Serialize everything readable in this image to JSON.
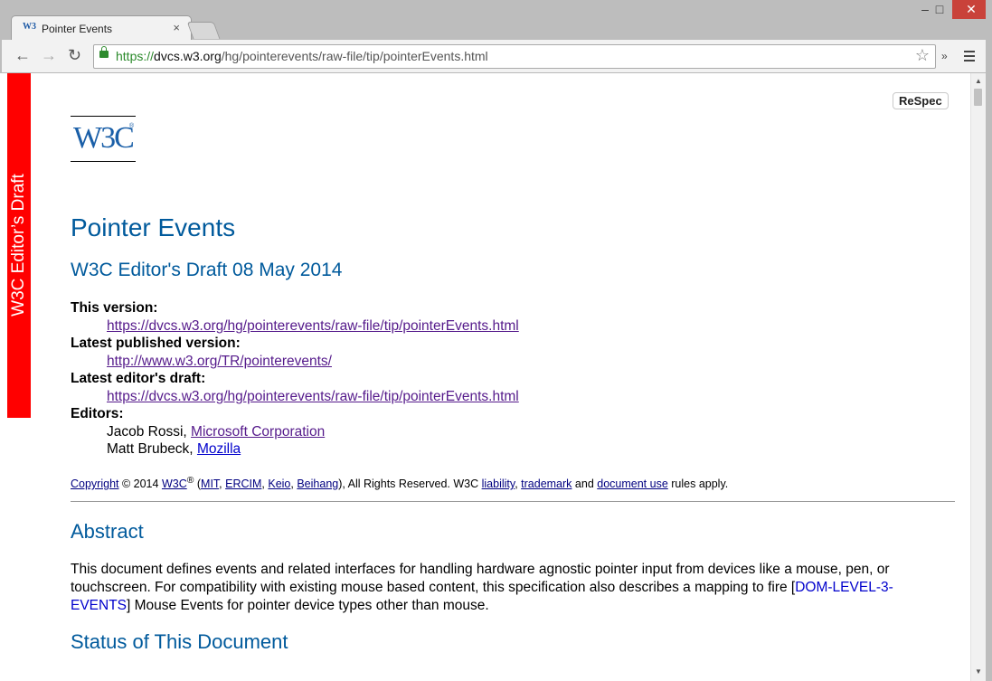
{
  "window": {
    "minimize_label": "–",
    "maximize_label": "□",
    "close_label": "✕"
  },
  "tab": {
    "favicon": "W3",
    "title": "Pointer Events",
    "close_label": "×"
  },
  "toolbar": {
    "back_icon": "←",
    "forward_icon": "→",
    "reload_icon": "↻",
    "star_icon": "☆",
    "extensions_label": "»"
  },
  "url": {
    "scheme": "https://",
    "host": "dvcs.w3.org",
    "path": "/hg/pointerevents/raw-file/tip/pointerEvents.html"
  },
  "page": {
    "ribbon": "W3C Editor’s Draft",
    "respec": "ReSpec",
    "logo": "W3C",
    "logo_reg": "®",
    "title": "Pointer Events",
    "subtitle": "W3C Editor's Draft 08 May 2014",
    "this_version_label": "This version:",
    "this_version_url": "https://dvcs.w3.org/hg/pointerevents/raw-file/tip/pointerEvents.html",
    "latest_published_label": "Latest published version:",
    "latest_published_url": "http://www.w3.org/TR/pointerevents/",
    "latest_draft_label": "Latest editor's draft:",
    "latest_draft_url": "https://dvcs.w3.org/hg/pointerevents/raw-file/tip/pointerEvents.html",
    "editors_label": "Editors:",
    "editors": [
      {
        "name": "Jacob Rossi, ",
        "org": "Microsoft Corporation"
      },
      {
        "name": "Matt Brubeck, ",
        "org": "Mozilla"
      }
    ],
    "copyright": {
      "copyright_link": "Copyright",
      "year_text": " © 2014 ",
      "w3c_link": "W3C",
      "reg": "®",
      "open_paren": " (",
      "mit": "MIT",
      "ercim": "ERCIM",
      "keio": "Keio",
      "beihang": "Beihang",
      "comma": ", ",
      "rights": "), All Rights Reserved. W3C ",
      "liability": "liability",
      "trademark": "trademark",
      "and": " and ",
      "document_use": "document use",
      "rules": " rules apply."
    },
    "abstract_heading": "Abstract",
    "abstract_before": "This document defines events and related interfaces for handling hardware agnostic pointer input from devices like a mouse, pen, or touchscreen. For compatibility with existing mouse based content, this specification also describes a mapping to fire [",
    "abstract_ref": "DOM-LEVEL-3-EVENTS",
    "abstract_after": "] Mouse Events for pointer device types other than mouse.",
    "status_heading": "Status of This Document"
  },
  "colors": {
    "ribbon": "#ff0000",
    "heading": "#005a9c",
    "link": "#0000cc",
    "visited_link": "#551a8b"
  }
}
